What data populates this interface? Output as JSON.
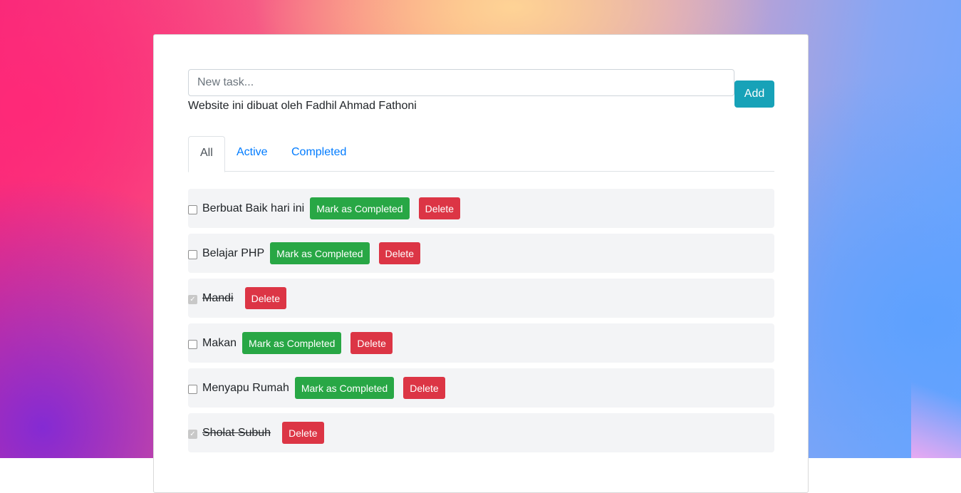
{
  "form": {
    "input_placeholder": "New task...",
    "input_value": "",
    "add_label": "Add",
    "credit": "Website ini dibuat oleh Fadhil Ahmad Fathoni"
  },
  "tabs": [
    {
      "label": "All",
      "active": true
    },
    {
      "label": "Active",
      "active": false
    },
    {
      "label": "Completed",
      "active": false
    }
  ],
  "tasks": [
    {
      "text": "Berbuat Baik hari ini",
      "completed": false,
      "complete_label": "Mark as Completed",
      "delete_label": "Delete"
    },
    {
      "text": "Belajar PHP",
      "completed": false,
      "complete_label": "Mark as Completed",
      "delete_label": "Delete"
    },
    {
      "text": "Mandi",
      "completed": true,
      "complete_label": "",
      "delete_label": "Delete"
    },
    {
      "text": "Makan",
      "completed": false,
      "complete_label": "Mark as Completed",
      "delete_label": "Delete"
    },
    {
      "text": "Menyapu Rumah",
      "completed": false,
      "complete_label": "Mark as Completed",
      "delete_label": "Delete"
    },
    {
      "text": "Sholat Subuh",
      "completed": true,
      "complete_label": "",
      "delete_label": "Delete"
    }
  ],
  "colors": {
    "add": "#17a2b8",
    "success": "#28a745",
    "danger": "#dc3545",
    "link": "#007bff"
  }
}
